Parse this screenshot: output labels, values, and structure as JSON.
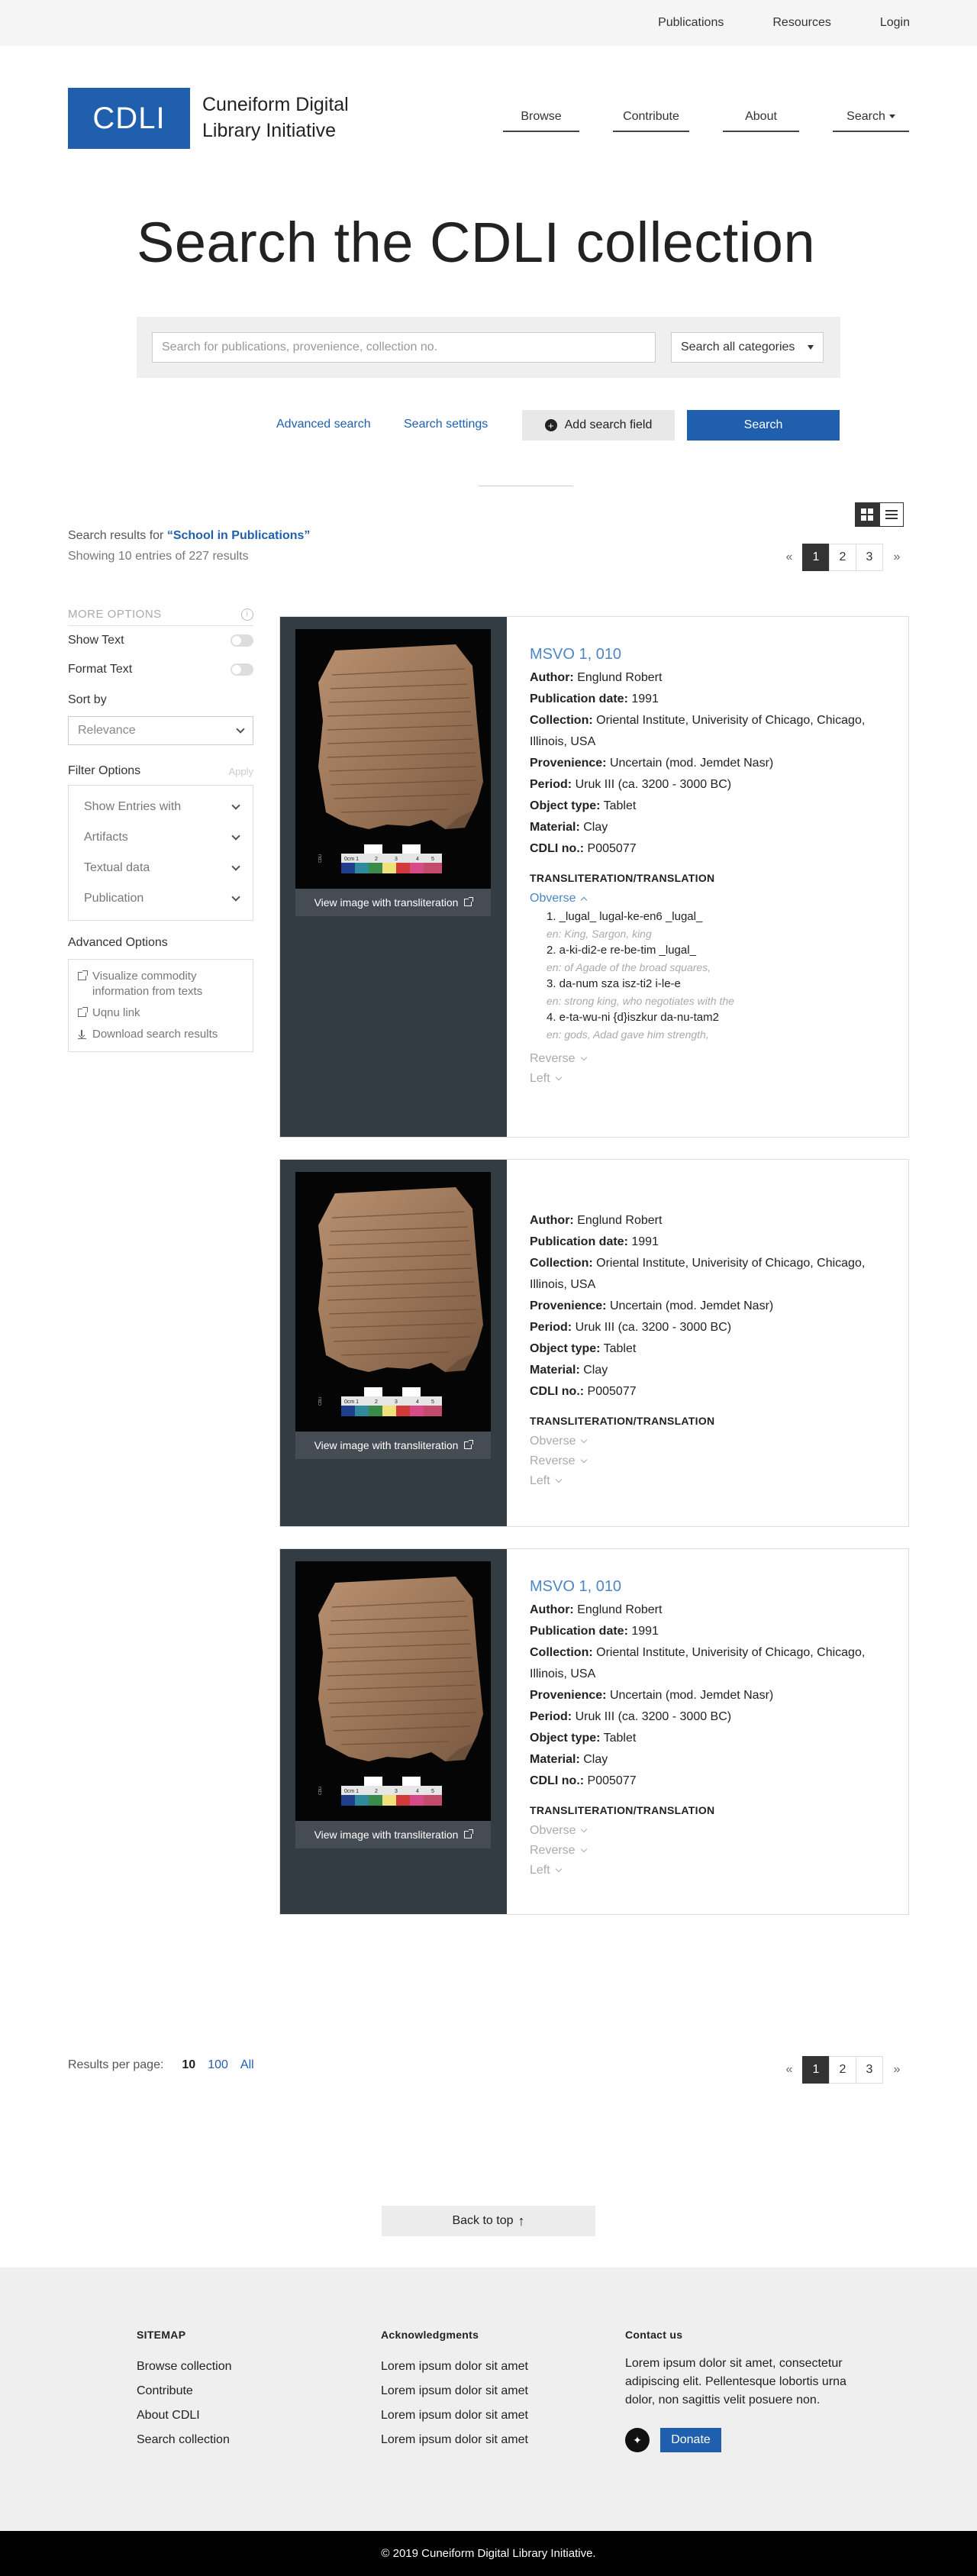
{
  "topbar": {
    "links": [
      "Publications",
      "Resources",
      "Login"
    ]
  },
  "header": {
    "logo": "CDLI",
    "org_line1": "Cuneiform Digital",
    "org_line2": "Library Initiative",
    "nav": [
      "Browse",
      "Contribute",
      "About",
      "Search"
    ]
  },
  "hero": {
    "title": "Search the CDLI collection",
    "search_placeholder": "Search for publications, provenience, collection no.",
    "category": "Search all categories",
    "advanced_search": "Advanced search",
    "search_settings": "Search settings",
    "add_field": "Add search field",
    "search_button": "Search"
  },
  "results": {
    "prefix": "Search results for ",
    "query": "“School in Publications”",
    "showing": "Showing 10 entries of 227 results",
    "pages": [
      "1",
      "2",
      "3"
    ],
    "prev": "«",
    "next": "»"
  },
  "sidebar": {
    "more_options": "MORE OPTIONS",
    "show_text": "Show Text",
    "format_text": "Format Text",
    "sort_by": "Sort by",
    "sort_value": "Relevance",
    "filter_options": "Filter Options",
    "apply": "Apply",
    "filters": [
      "Show Entries with",
      "Artifacts",
      "Textual data",
      "Publication"
    ],
    "advanced_options": "Advanced Options",
    "visualize": "Visualize commodity information from texts",
    "uqnu": "Uqnu link",
    "download": "Download search results"
  },
  "labels": {
    "author": "Author:",
    "pub_date": "Publication date:",
    "collection": "Collection:",
    "provenience": "Provenience:",
    "period": "Period:",
    "object_type": "Object type:",
    "material": "Material:",
    "cdli_no": "CDLI no.:",
    "translit": "TRANSLITERATION/TRANSLATION",
    "view_image": "View image with transliteration",
    "obverse": "Obverse",
    "reverse": "Reverse",
    "left": "Left"
  },
  "cards": [
    {
      "title": "MSVO 1, 010",
      "author": "Englund Robert",
      "pub_date": "1991",
      "collection": "Oriental Institute, Univerisity of Chicago, Chicago, Illinois, USA",
      "provenience": "Uncertain (mod. Jemdet Nasr)",
      "period": "Uruk III (ca. 3200 - 3000 BC)",
      "object_type": "Tablet",
      "material": "Clay",
      "cdli_no": "P005077",
      "lines": [
        {
          "text": "1. _lugal_ lugal-ke-en6 _lugal_",
          "en": "en: King, Sargon, king"
        },
        {
          "text": "2. a-ki-di2-e re-be-tim _lugal_",
          "en": "en: of Agade of the broad squares,"
        },
        {
          "text": "3. da-num sza isz-ti2 i-le-e",
          "en": "en: strong king, who negotiates with the"
        },
        {
          "text": "4. e-ta-wu-ni {d}iszkur da-nu-tam2",
          "en": "en: gods, Adad gave him strength,"
        }
      ]
    },
    {
      "title": "",
      "author": "Englund Robert",
      "pub_date": "1991",
      "collection": "Oriental Institute, Univerisity of Chicago, Chicago, Illinois, USA",
      "provenience": "Uncertain (mod. Jemdet Nasr)",
      "period": "Uruk III (ca. 3200 - 3000 BC)",
      "object_type": "Tablet",
      "material": "Clay",
      "cdli_no": "P005077"
    },
    {
      "title": "MSVO 1, 010",
      "author": "Englund Robert",
      "pub_date": "1991",
      "collection": "Oriental Institute, Univerisity of Chicago, Chicago, Illinois, USA",
      "provenience": "Uncertain (mod. Jemdet Nasr)",
      "period": "Uruk III (ca. 3200 - 3000 BC)",
      "object_type": "Tablet",
      "material": "Clay",
      "cdli_no": "P005077"
    }
  ],
  "bottom": {
    "rpp_label": "Results per page:",
    "rpp_options": [
      "10",
      "100",
      "All"
    ],
    "back_to_top": "Back to top"
  },
  "footer": {
    "sitemap": "SITEMAP",
    "sitemap_links": [
      "Browse collection",
      "Contribute",
      "About CDLI",
      "Search collection"
    ],
    "ack": "Acknowledgments",
    "ack_links": [
      "Lorem ipsum dolor sit amet",
      "Lorem ipsum dolor sit amet",
      "Lorem ipsum dolor sit amet",
      "Lorem ipsum dolor sit amet"
    ],
    "contact": "Contact us",
    "contact_text": "Lorem ipsum dolor sit amet, consectetur adipiscing elit. Pellentesque lobortis urna dolor, non sagittis velit posuere non.",
    "donate": "Donate",
    "copyright": "© 2019 Cuneiform Digital Library Initiative."
  },
  "colors": {
    "brand": "#1f5fae",
    "link": "#4a86c8",
    "image_panel": "#333b43"
  }
}
